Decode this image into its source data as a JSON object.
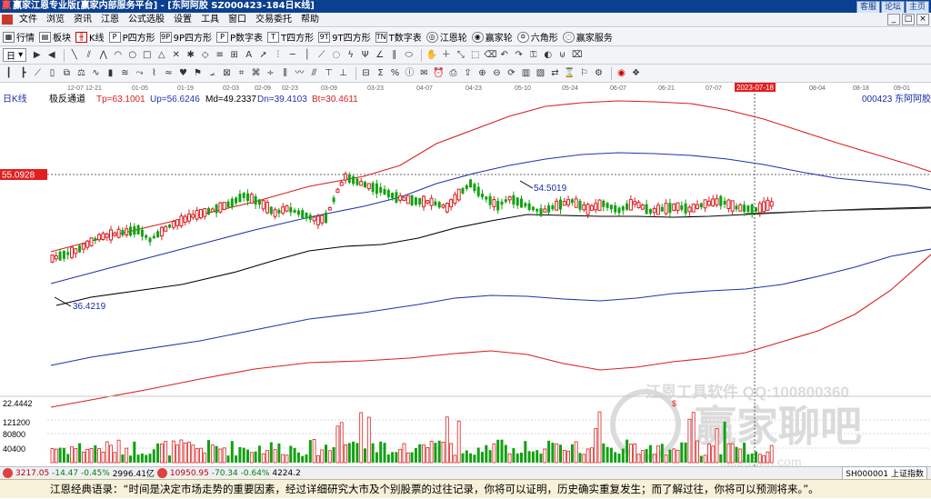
{
  "window": {
    "title": "赢家江恩专业版[赢家内部服务平台] - [东阿阿胶  SZ000423-184日K线]",
    "logo": "赢",
    "right_buttons": [
      "客服",
      "论坛",
      "主页"
    ],
    "win_controls": [
      "_",
      "□",
      "×"
    ]
  },
  "menu": [
    "文件",
    "浏览",
    "资讯",
    "江恩",
    "公式选股",
    "设置",
    "工具",
    "窗口",
    "交易委托",
    "帮助"
  ],
  "toolbar1": [
    {
      "icon": "grid",
      "label": "行情"
    },
    {
      "icon": "board",
      "label": "板块"
    },
    {
      "icon": "kline",
      "label": "K线"
    },
    {
      "icon": "P",
      "label": "P四方形"
    },
    {
      "icon": "9P",
      "label": "9P四方形"
    },
    {
      "icon": "P",
      "label": "P数字表"
    },
    {
      "icon": "T",
      "label": "T四方形"
    },
    {
      "icon": "9T",
      "label": "9T四方形"
    },
    {
      "icon": "TN",
      "label": "T数字表"
    },
    {
      "icon": "wheel",
      "label": "江恩轮"
    },
    {
      "icon": "wheel2",
      "label": "赢家轮"
    },
    {
      "icon": "hex",
      "label": "六角形"
    },
    {
      "icon": "svc",
      "label": "赢家服务"
    }
  ],
  "period_select": "日",
  "dates": [
    "12-07",
    "12-21",
    "01-05",
    "01-19",
    "02-03",
    "02-09",
    "02-23",
    "03-09",
    "03-23",
    "04-07",
    "04-23",
    "05-10",
    "05-24",
    "06-07",
    "06-21",
    "07-07",
    "2023-07-18",
    "08-04",
    "08-18",
    "09-01"
  ],
  "indicator": {
    "chart_label": "日K线",
    "name": "极反通道",
    "tp": "Tp=63.1001",
    "up": "Up=56.6246",
    "md": "Md=49.2337",
    "dn": "Dn=39.4103",
    "bt": "Bt=30.4611",
    "code": "000423",
    "stock": "东阿阿胶"
  },
  "price_marker": "55.0928",
  "annotations": {
    "high": "54.5019",
    "low": "36.4219"
  },
  "volume": {
    "max_label": "22.4442",
    "axis": [
      "121200",
      "80800",
      "40400"
    ]
  },
  "watermark": {
    "line1": "江恩工具软件  QQ:100800360",
    "line2": "赢家聊吧",
    "line3": "iaoba.win.com"
  },
  "status": {
    "sh_index": "3217.05",
    "sh_change": "-14.47",
    "sh_pct": "-0.45%",
    "sh_amount": "2996.41亿",
    "sz_index": "10950.95",
    "sz_change": "-70.34",
    "sz_pct": "-0.64%",
    "sz_amount": "4224.2",
    "right": "SH000001 上证指数"
  },
  "quote": "江恩经典语录：“时间是决定市场走势的重要因素，经过详细研究大市及个别股票的过往记录，你将可以证明，历史确实重复发生；而了解过往，你将可以预测将来。”。",
  "colors": {
    "red": "#d92020",
    "blue": "#2233aa",
    "green": "#11a111",
    "marker": "#e31f1f"
  },
  "chart_data": {
    "type": "candlestick",
    "anchors": [
      [
        0,
        47.5
      ],
      [
        6,
        48.3
      ],
      [
        12,
        49.8
      ],
      [
        18,
        50.3
      ],
      [
        22,
        50.6
      ],
      [
        25,
        49.5
      ],
      [
        30,
        51.0
      ],
      [
        36,
        52.1
      ],
      [
        41,
        52.7
      ],
      [
        46,
        53.5
      ],
      [
        49,
        54.3
      ],
      [
        53,
        53.6
      ],
      [
        57,
        52.4
      ],
      [
        60,
        52.9
      ],
      [
        64,
        52.3
      ],
      [
        68,
        51.6
      ],
      [
        70,
        51.9
      ],
      [
        73,
        54.8
      ],
      [
        75,
        56.3
      ],
      [
        79,
        55.6
      ],
      [
        84,
        54.9
      ],
      [
        88,
        54.1
      ],
      [
        93,
        53.7
      ],
      [
        97,
        53.6
      ],
      [
        101,
        53.0
      ],
      [
        104,
        54.4
      ],
      [
        107,
        55.6
      ],
      [
        110,
        54.3
      ],
      [
        114,
        53.2
      ],
      [
        117,
        54.0
      ],
      [
        121,
        53.3
      ],
      [
        125,
        52.5
      ],
      [
        129,
        53.2
      ],
      [
        133,
        53.7
      ],
      [
        137,
        52.8
      ],
      [
        141,
        53.4
      ],
      [
        145,
        52.7
      ],
      [
        149,
        53.5
      ],
      [
        153,
        52.6
      ],
      [
        157,
        52.9
      ],
      [
        160,
        53.1
      ],
      [
        163,
        52.8
      ],
      [
        167,
        53.4
      ],
      [
        171,
        53.7
      ],
      [
        175,
        53.0
      ],
      [
        180,
        52.8
      ],
      [
        184,
        53.4
      ]
    ],
    "volume_range": [
      0,
      160000
    ],
    "price_range": [
      30.4611,
      63.1001
    ]
  }
}
